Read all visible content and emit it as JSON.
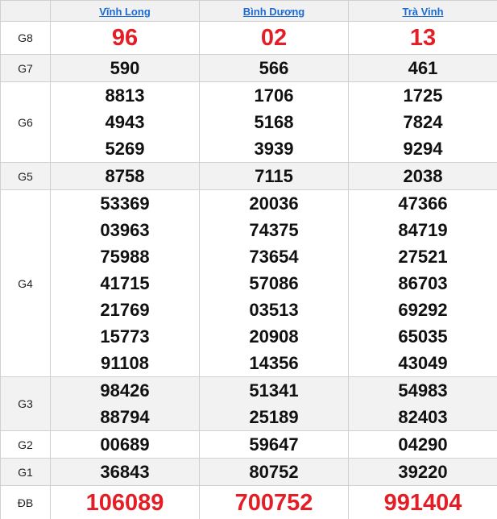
{
  "header": {
    "provinces": [
      "Vĩnh Long",
      "Bình Dương",
      "Trà Vinh"
    ]
  },
  "prizes": [
    {
      "label": "G8",
      "values": [
        [
          "96"
        ],
        [
          "02"
        ],
        [
          "13"
        ]
      ],
      "style": "red"
    },
    {
      "label": "G7",
      "values": [
        [
          "590"
        ],
        [
          "566"
        ],
        [
          "461"
        ]
      ],
      "style": "normal"
    },
    {
      "label": "G6",
      "values": [
        [
          "8813",
          "4943",
          "5269"
        ],
        [
          "1706",
          "5168",
          "3939"
        ],
        [
          "1725",
          "7824",
          "9294"
        ]
      ],
      "style": "normal"
    },
    {
      "label": "G5",
      "values": [
        [
          "8758"
        ],
        [
          "7115"
        ],
        [
          "2038"
        ]
      ],
      "style": "normal"
    },
    {
      "label": "G4",
      "values": [
        [
          "53369",
          "03963",
          "75988",
          "41715",
          "21769",
          "15773",
          "91108"
        ],
        [
          "20036",
          "74375",
          "73654",
          "57086",
          "03513",
          "20908",
          "14356"
        ],
        [
          "47366",
          "84719",
          "27521",
          "86703",
          "69292",
          "65035",
          "43049"
        ]
      ],
      "style": "normal"
    },
    {
      "label": "G3",
      "values": [
        [
          "98426",
          "88794"
        ],
        [
          "51341",
          "25189"
        ],
        [
          "54983",
          "82403"
        ]
      ],
      "style": "normal"
    },
    {
      "label": "G2",
      "values": [
        [
          "00689"
        ],
        [
          "59647"
        ],
        [
          "04290"
        ]
      ],
      "style": "normal"
    },
    {
      "label": "G1",
      "values": [
        [
          "36843"
        ],
        [
          "80752"
        ],
        [
          "39220"
        ]
      ],
      "style": "normal"
    },
    {
      "label": "ĐB",
      "values": [
        [
          "106089"
        ],
        [
          "700752"
        ],
        [
          "991404"
        ]
      ],
      "style": "special"
    }
  ],
  "colors": {
    "link": "#1a6bd6",
    "highlight_red": "#e41e26",
    "alt_row": "#f2f2f2",
    "border": "#d0d0d0"
  }
}
